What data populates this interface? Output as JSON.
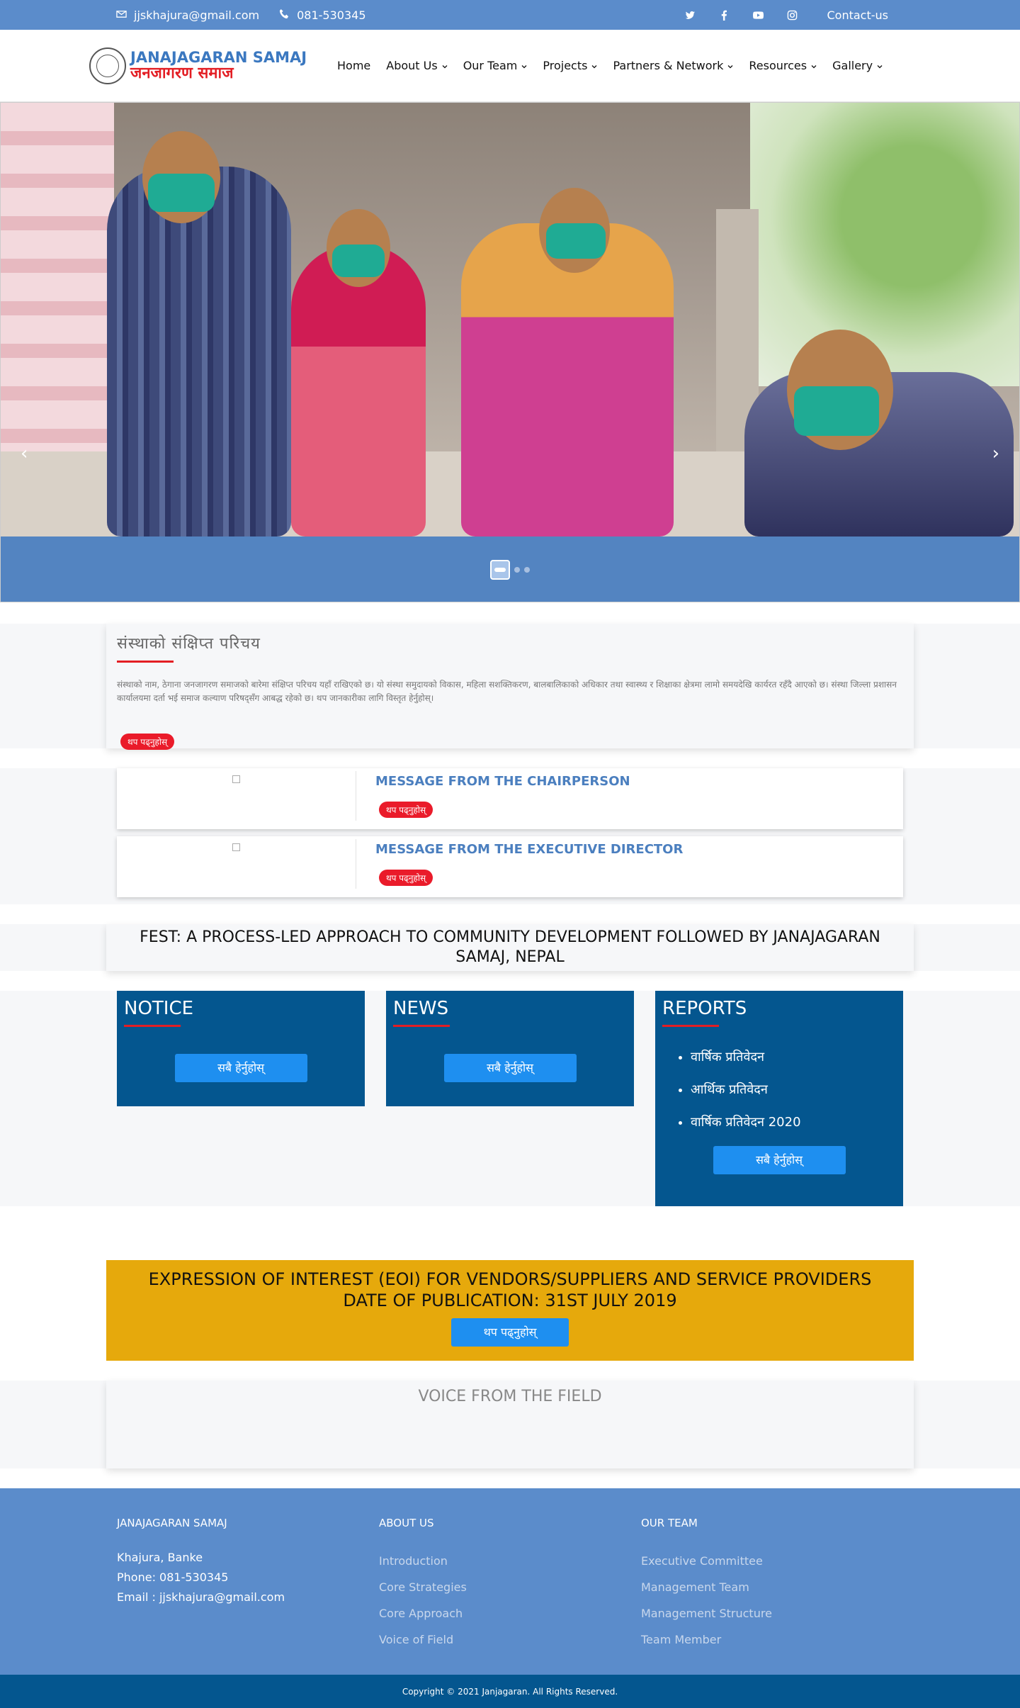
{
  "topbar": {
    "email": "jjskhajura@gmail.com",
    "phone": "081-530345",
    "contact": "Contact-us",
    "social": [
      "twitter-icon",
      "facebook-icon",
      "youtube-icon",
      "instagram-icon"
    ]
  },
  "header": {
    "logo_en": "JANAJAGARAN SAMAJ",
    "logo_np": "जनजागरण समाज",
    "nav": [
      {
        "label": "Home",
        "dropdown": false
      },
      {
        "label": "About Us",
        "dropdown": true
      },
      {
        "label": "Our Team",
        "dropdown": true
      },
      {
        "label": "Projects",
        "dropdown": true
      },
      {
        "label": "Partners & Network",
        "dropdown": true
      },
      {
        "label": "Resources",
        "dropdown": true
      },
      {
        "label": "Gallery",
        "dropdown": true
      }
    ]
  },
  "hero": {
    "slides": 3,
    "active_slide": 1
  },
  "intro": {
    "title": "संस्थाको संक्षिप्त परिचय",
    "text": "संस्थाको नाम, ठेगाना जनजागरण समाजको बारेमा संक्षिप्त परिचय यहाँ राखिएको छ। यो संस्था समुदायको विकास, महिला सशक्तिकरण, बालबालिकाको अधिकार तथा स्वास्थ्य र शिक्षाका क्षेत्रमा लामो समयदेखि कार्यरत रहँदै आएको छ। संस्था जिल्ला प्रशासन कार्यालयमा दर्ता भई समाज कल्याण परिषद्सँग आबद्ध रहेको छ। थप जानकारीका लागि विस्तृत हेर्नुहोस्।",
    "more": "थप पढ्नुहोस्"
  },
  "messages": [
    {
      "title": "MESSAGE FROM THE CHAIRPERSON",
      "more": "थप पढ्नुहोस्"
    },
    {
      "title": "MESSAGE FROM THE EXECUTIVE DIRECTOR",
      "more": "थप पढ्नुहोस्"
    }
  ],
  "fest": {
    "title": "FEST: A PROCESS-LED APPROACH TO COMMUNITY DEVELOPMENT FOLLOWED BY JANAJAGARAN SAMAJ, NEPAL"
  },
  "columns": {
    "notice": {
      "title": "NOTICE",
      "button": "सबै हेर्नुहोस्"
    },
    "news": {
      "title": "NEWS",
      "button": "सबै हेर्नुहोस्"
    },
    "reports": {
      "title": "REPORTS",
      "items": [
        "वार्षिक प्रतिवेदन",
        "आर्थिक प्रतिवेदन",
        "वार्षिक प्रतिवेदन 2020"
      ],
      "button": "सबै हेर्नुहोस्"
    }
  },
  "eoi": {
    "title": "EXPRESSION OF INTEREST (EOI) FOR VENDORS/SUPPLIERS AND SERVICE PROVIDERS DATE OF PUBLICATION: 31ST JULY 2019",
    "button": "थप पढ्नुहोस्"
  },
  "voice": {
    "title": "VOICE FROM THE FIELD"
  },
  "footer": {
    "org": {
      "title": "JANAJAGARAN SAMAJ",
      "address": "Khajura, Banke",
      "phone": "Phone: 081-530345",
      "email": "Email : jjskhajura@gmail.com"
    },
    "about": {
      "title": "ABOUT US",
      "links": [
        "Introduction",
        "Core Strategies",
        "Core Approach",
        "Voice of Field"
      ]
    },
    "team": {
      "title": "OUR TEAM",
      "links": [
        "Executive Committee",
        "Management Team",
        "Management Structure",
        "Team Member"
      ]
    },
    "copyright": "Copyright © 2021 Janjagaran. All Rights Reserved."
  },
  "colors": {
    "topbar": "#5b8ccb",
    "accent_red": "#e31e24",
    "dark_blue": "#04568f",
    "button_blue": "#1e8ff0",
    "eoi_yellow": "#e6a90c"
  }
}
